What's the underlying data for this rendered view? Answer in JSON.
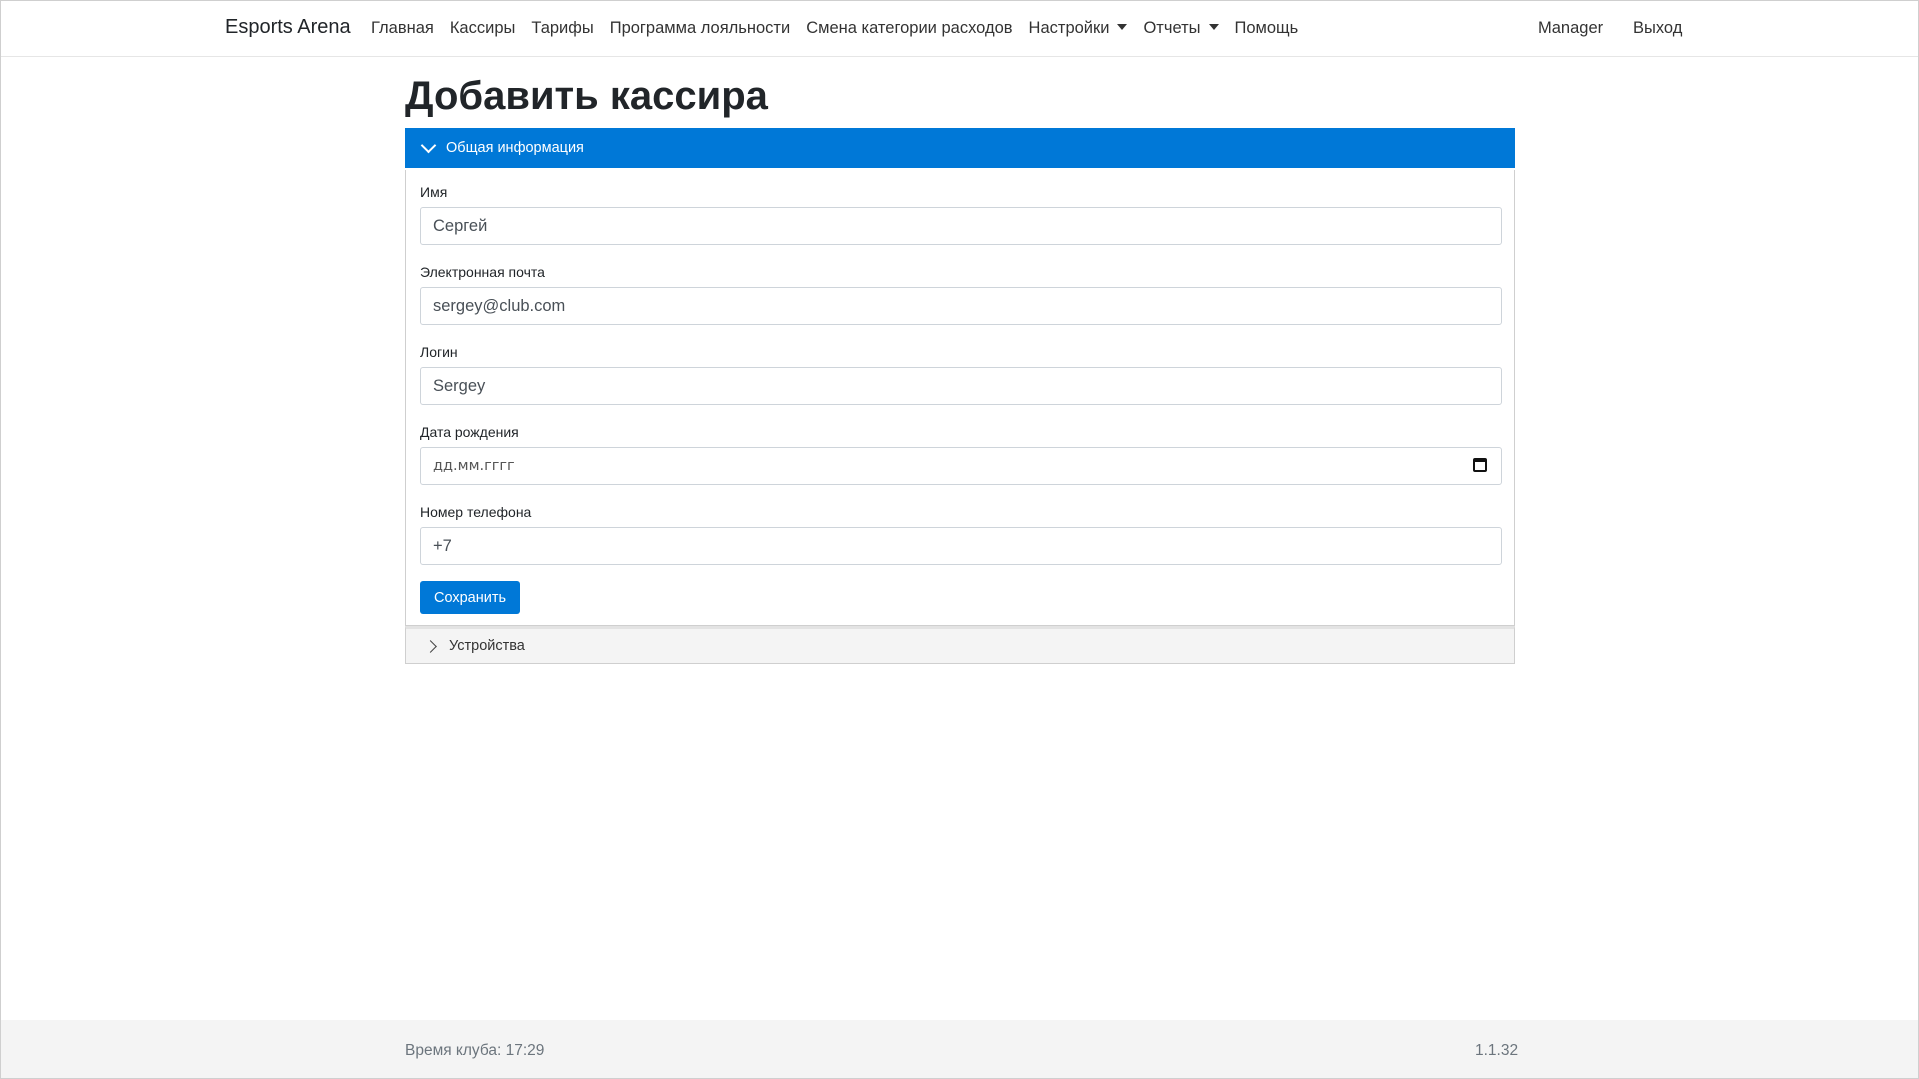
{
  "navbar": {
    "brand": "Esports Arena",
    "links": [
      "Главная",
      "Кассиры",
      "Тарифы",
      "Программа лояльности",
      "Смена категории расходов"
    ],
    "settings": "Настройки",
    "reports": "Отчеты",
    "help": "Помощь",
    "user": "Manager",
    "logout": "Выход"
  },
  "page": {
    "title": "Добавить кассира"
  },
  "general_section": {
    "header": "Общая информация",
    "name_label": "Имя",
    "name_value": "Сергей",
    "email_label": "Электронная почта",
    "email_value": "sergey@club.com",
    "login_label": "Логин",
    "login_value": "Sergey",
    "birthdate_label": "Дата рождения",
    "birthdate_placeholder": "дд.мм.гггг",
    "phone_label": "Номер телефона",
    "phone_value": "+7",
    "save_label": "Сохранить"
  },
  "devices_section": {
    "header": "Устройства"
  },
  "footer": {
    "club_time": "Время клуба: 17:29",
    "version": "1.1.32"
  },
  "colors": {
    "accent": "#0078d7",
    "footer_bg": "#f4f4f4"
  }
}
